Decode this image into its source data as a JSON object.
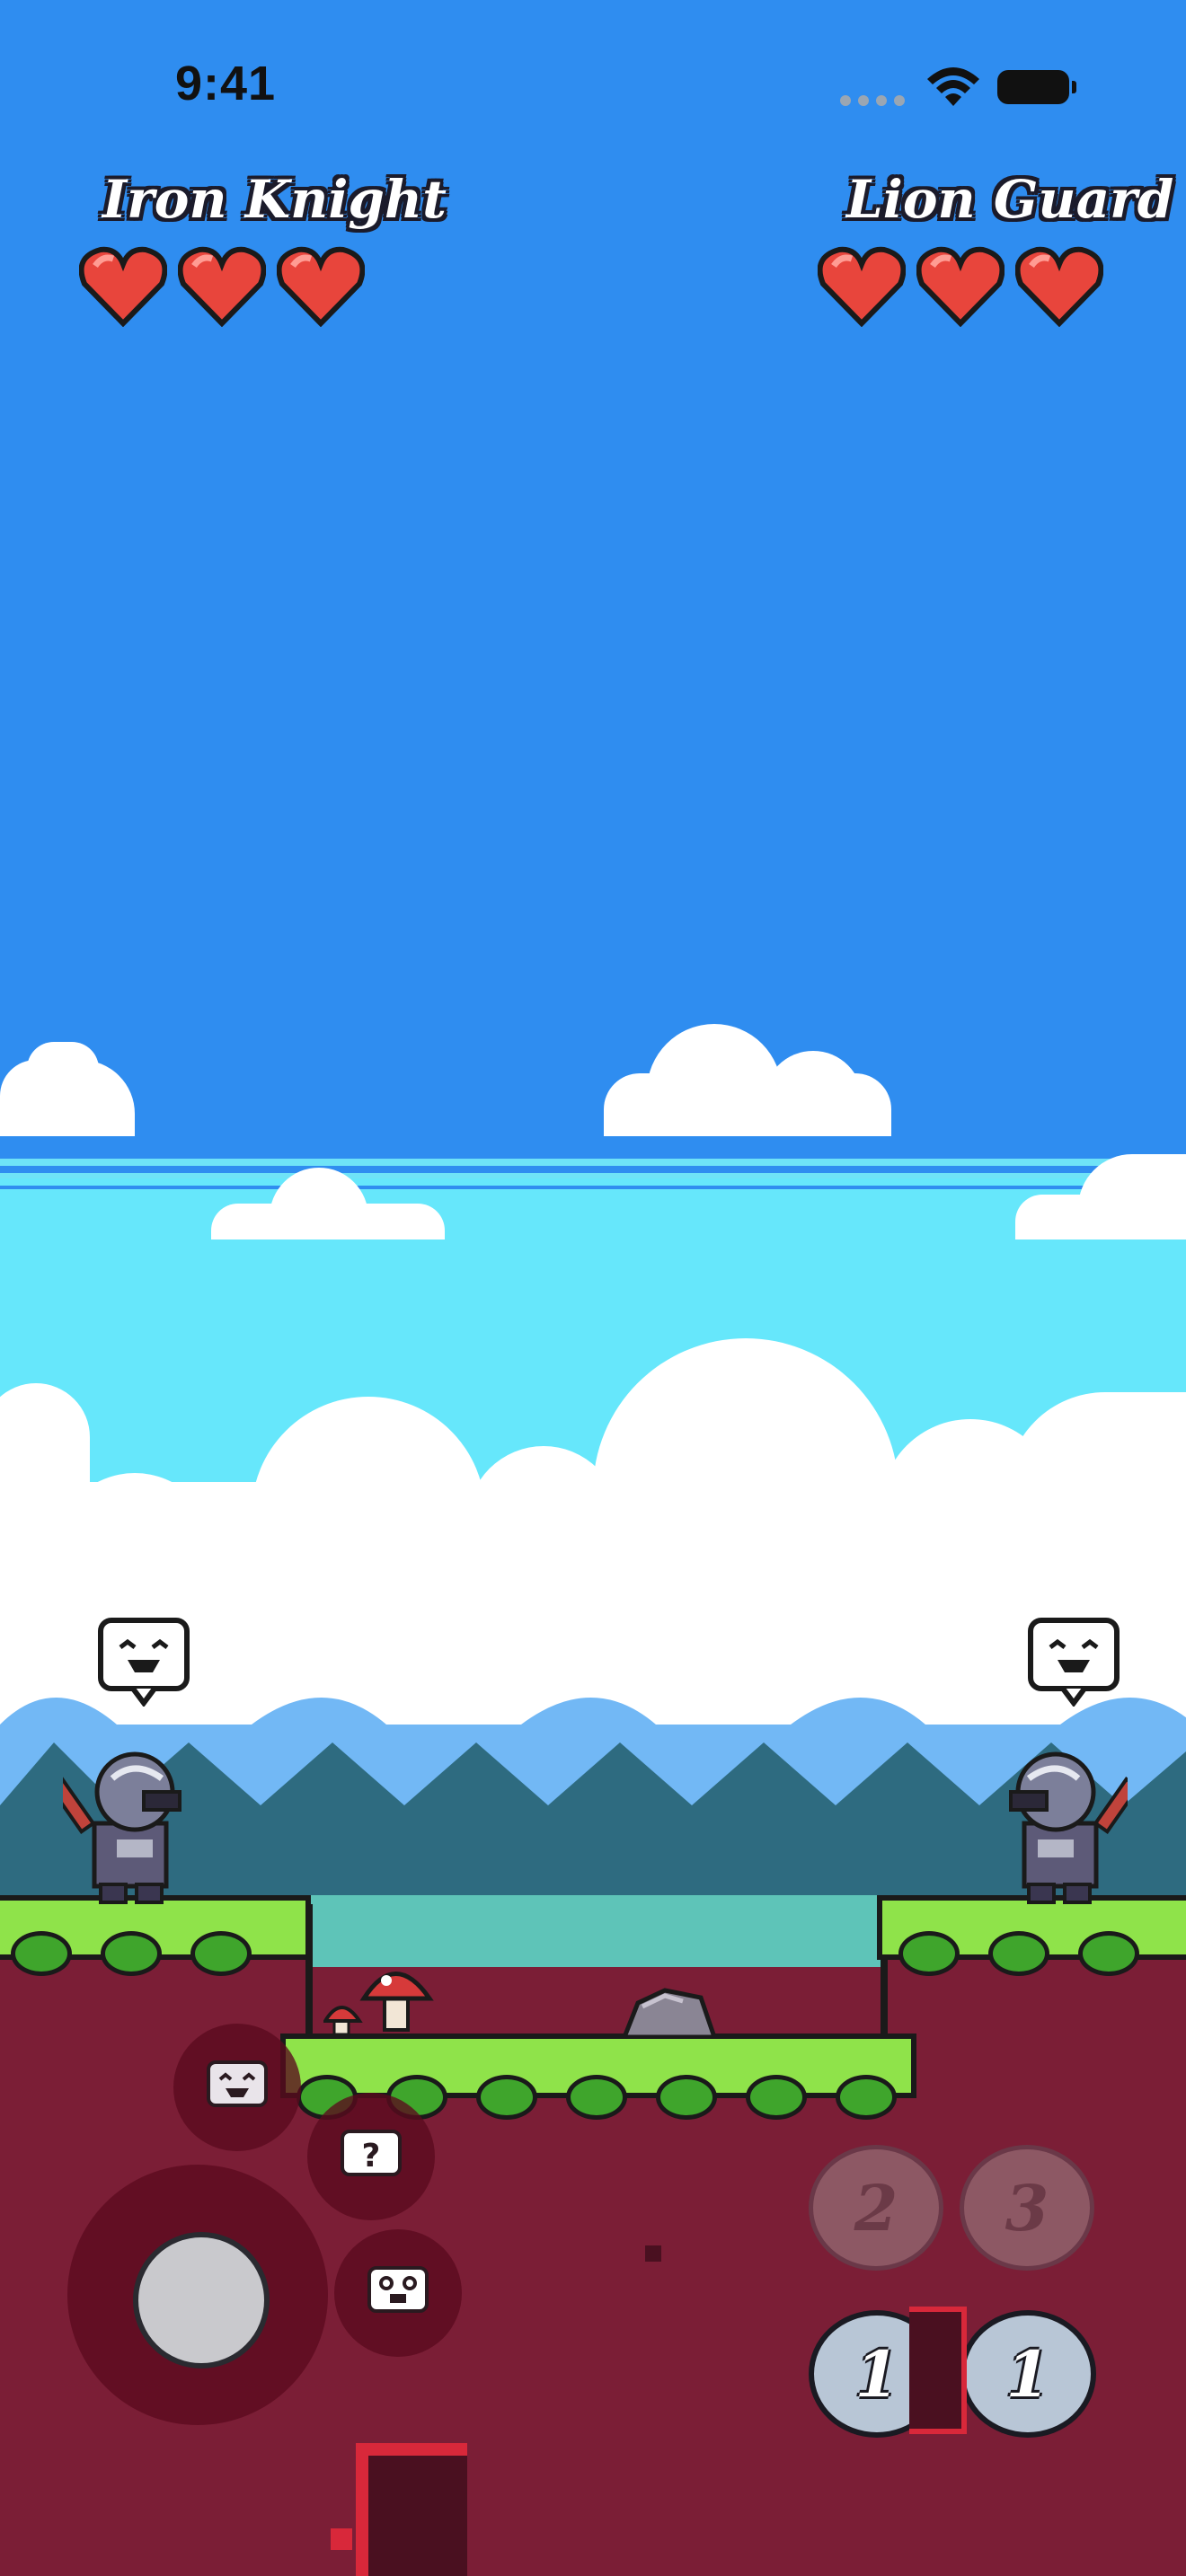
{
  "status_bar": {
    "time": "9:41",
    "wifi_icon": "wifi-icon",
    "battery_icon": "battery-icon"
  },
  "players": {
    "left": {
      "name": "Iron Knight",
      "hearts": 3,
      "max_hearts": 3
    },
    "right": {
      "name": "Lion Guard",
      "hearts": 3,
      "max_hearts": 3
    }
  },
  "emotes": {
    "left_bubble": "happy-face-icon",
    "right_bubble": "happy-face-icon",
    "buttons": [
      "happy-face-icon",
      "question-face-icon",
      "surprised-face-icon"
    ]
  },
  "controls": {
    "joystick": "joystick",
    "action_buttons": [
      {
        "label": "2",
        "state": "disabled"
      },
      {
        "label": "3",
        "state": "disabled"
      },
      {
        "label": "1",
        "state": "enabled"
      },
      {
        "label": "1",
        "state": "enabled"
      }
    ]
  },
  "colors": {
    "sky": "#2f8df0",
    "sky_low": "#66e7fb",
    "grass": "#8fe34a",
    "dirt": "#7b1e36",
    "heart": "#e8453c"
  }
}
